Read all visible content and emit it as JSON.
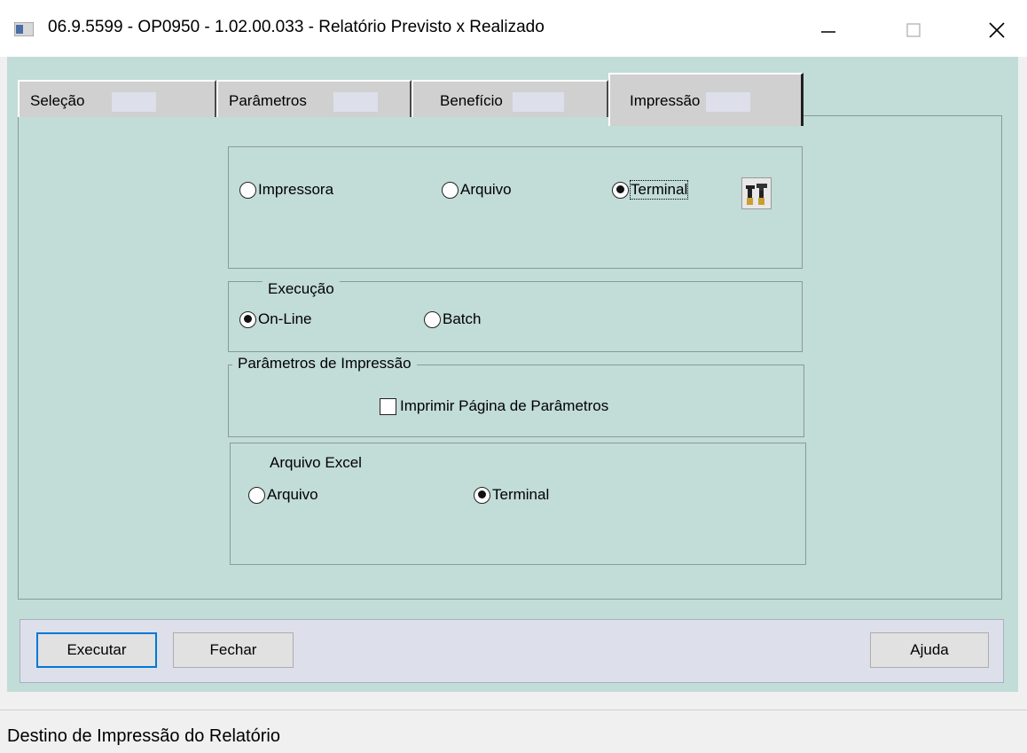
{
  "window": {
    "title": "06.9.5599 - OP0950 - 1.02.00.033 - Relatório Previsto x Realizado",
    "minimize_icon": "minimize-icon",
    "maximize_icon": "maximize-icon",
    "close_icon": "close-icon"
  },
  "tabs": [
    {
      "label": "Seleção"
    },
    {
      "label": "Parâmetros"
    },
    {
      "label": "Benefício"
    },
    {
      "label": "Impressão",
      "active": true
    }
  ],
  "destino": {
    "options": [
      {
        "label": "Impressora",
        "checked": false
      },
      {
        "label": "Arquivo",
        "checked": false
      },
      {
        "label": "Terminal",
        "checked": true
      }
    ],
    "config_icon": "tools-icon"
  },
  "execucao": {
    "legend": "Execução",
    "options": [
      {
        "label": "On-Line",
        "checked": true
      },
      {
        "label": "Batch",
        "checked": false
      }
    ]
  },
  "parametros_impressao": {
    "legend": "Parâmetros de Impressão",
    "checkbox_label": "Imprimir Página de Parâmetros",
    "checked": false
  },
  "arquivo_excel": {
    "legend": "Arquivo Excel",
    "options": [
      {
        "label": "Arquivo",
        "checked": false
      },
      {
        "label": "Terminal",
        "checked": true
      }
    ]
  },
  "buttons": {
    "executar": "Executar",
    "fechar": "Fechar",
    "ajuda": "Ajuda"
  },
  "status": "Destino de Impressão do Relatório"
}
